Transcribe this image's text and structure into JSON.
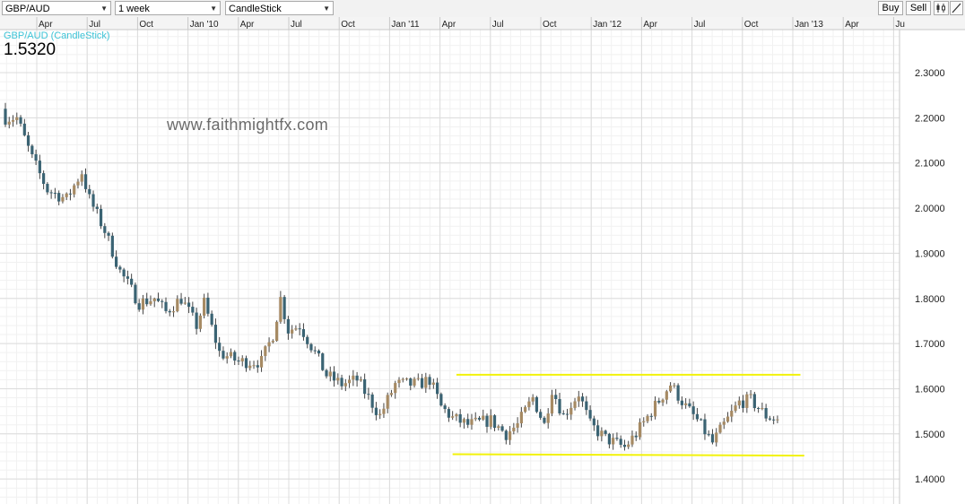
{
  "toolbar": {
    "symbol": "GBP/AUD",
    "interval": "1 week",
    "chart_style": "CandleStick",
    "buy_label": "Buy",
    "sell_label": "Sell"
  },
  "header": {
    "series_label": "GBP/AUD (CandleStick)",
    "last_price": "1.5320",
    "watermark": "www.faithmightfx.com"
  },
  "colors": {
    "bull": "#a68a63",
    "bear": "#3a6373",
    "wick": "#444444",
    "trendline": "#f2f20a",
    "series_label": "#3cc3d6"
  },
  "chart_data": {
    "type": "candlestick",
    "title": "GBP/AUD (CandleStick)",
    "interval": "1 week",
    "x_ticks": [
      "Apr",
      "Jul",
      "Oct",
      "Jan '10",
      "Apr",
      "Jul",
      "Oct",
      "Jan '11",
      "Apr",
      "Jul",
      "Oct",
      "Jan '12",
      "Apr",
      "Jul",
      "Oct",
      "Jan '13",
      "Apr",
      "Ju"
    ],
    "y_ticks": [
      "2.3000",
      "2.2000",
      "2.1000",
      "2.0000",
      "1.9000",
      "1.8000",
      "1.7000",
      "1.6000",
      "1.5000",
      "1.4000"
    ],
    "ylim": [
      1.37,
      2.41
    ],
    "grid": true,
    "last_price": 1.532,
    "trendlines": [
      {
        "name": "resistance",
        "start": [
          "2011-04-11",
          1.631
        ],
        "end": [
          "2012-12-31",
          1.631
        ]
      },
      {
        "name": "support",
        "start": [
          "2011-04-04",
          1.455
        ],
        "end": [
          "2013-01-07",
          1.452
        ]
      }
    ],
    "key_closes": [
      [
        "2009-01-05",
        2.2
      ],
      [
        "2009-01-26",
        2.2
      ],
      [
        "2009-02-23",
        2.11
      ],
      [
        "2009-03-23",
        2.04
      ],
      [
        "2009-04-27",
        2.02
      ],
      [
        "2009-05-25",
        2.08
      ],
      [
        "2009-06-08",
        2.02
      ],
      [
        "2009-07-06",
        1.95
      ],
      [
        "2009-08-03",
        1.86
      ],
      [
        "2009-09-07",
        1.79
      ],
      [
        "2009-10-05",
        1.8
      ],
      [
        "2009-10-26",
        1.77
      ],
      [
        "2009-11-23",
        1.8
      ],
      [
        "2009-12-21",
        1.74
      ],
      [
        "2010-01-04",
        1.79
      ],
      [
        "2010-02-01",
        1.68
      ],
      [
        "2010-03-08",
        1.66
      ],
      [
        "2010-04-19",
        1.66
      ],
      [
        "2010-05-10",
        1.72
      ],
      [
        "2010-05-24",
        1.8
      ],
      [
        "2010-06-07",
        1.73
      ],
      [
        "2010-06-28",
        1.74
      ],
      [
        "2010-07-26",
        1.68
      ],
      [
        "2010-08-16",
        1.63
      ],
      [
        "2010-09-13",
        1.61
      ],
      [
        "2010-10-11",
        1.62
      ],
      [
        "2010-11-22",
        1.54
      ],
      [
        "2010-12-20",
        1.61
      ],
      [
        "2011-01-31",
        1.61
      ],
      [
        "2011-02-21",
        1.62
      ],
      [
        "2011-03-14",
        1.56
      ],
      [
        "2011-04-04",
        1.535
      ],
      [
        "2011-05-02",
        1.52
      ],
      [
        "2011-06-13",
        1.53
      ],
      [
        "2011-07-11",
        1.5
      ],
      [
        "2011-08-01",
        1.52
      ],
      [
        "2011-08-29",
        1.58
      ],
      [
        "2011-09-19",
        1.52
      ],
      [
        "2011-10-03",
        1.6
      ],
      [
        "2011-10-24",
        1.54
      ],
      [
        "2011-11-21",
        1.59
      ],
      [
        "2011-12-12",
        1.52
      ],
      [
        "2012-01-09",
        1.49
      ],
      [
        "2012-02-13",
        1.47
      ],
      [
        "2012-03-05",
        1.5
      ],
      [
        "2012-04-02",
        1.55
      ],
      [
        "2012-05-07",
        1.61
      ],
      [
        "2012-06-04",
        1.56
      ],
      [
        "2012-06-25",
        1.53
      ],
      [
        "2012-07-23",
        1.48
      ],
      [
        "2012-08-13",
        1.52
      ],
      [
        "2012-09-10",
        1.57
      ],
      [
        "2012-10-01",
        1.575
      ],
      [
        "2012-10-29",
        1.54
      ],
      [
        "2012-11-19",
        1.532
      ]
    ]
  }
}
